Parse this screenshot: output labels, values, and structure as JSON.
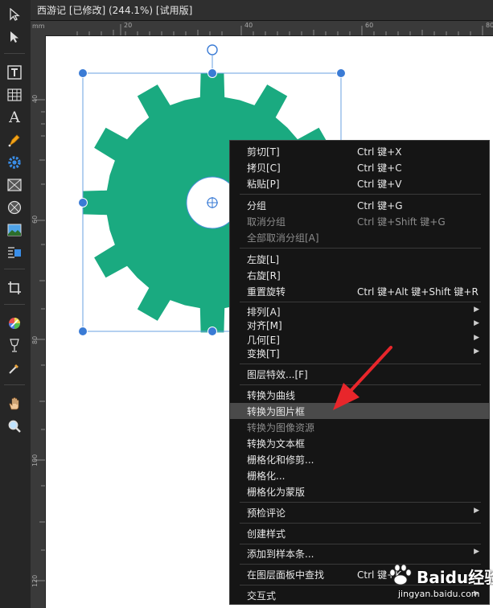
{
  "window": {
    "title": "西游记 [已修改] (244.1%) [试用版]"
  },
  "ruler": {
    "unit": "mm",
    "top_ticks": [
      "20",
      "40",
      "60",
      "80"
    ],
    "left_ticks": [
      "40",
      "60",
      "80",
      "100",
      "120"
    ]
  },
  "tools": [
    {
      "icon": "move-tool-icon"
    },
    {
      "icon": "node-tool-icon"
    },
    {
      "icon": "frame-text-tool-icon"
    },
    {
      "icon": "table-tool-icon"
    },
    {
      "icon": "artistic-text-tool-icon"
    },
    {
      "icon": "pen-tool-icon"
    },
    {
      "icon": "shape-tool-icon"
    },
    {
      "icon": "picture-frame-rectangle-icon"
    },
    {
      "icon": "picture-frame-ellipse-icon"
    },
    {
      "icon": "place-image-icon"
    },
    {
      "icon": "text-wrap-icon"
    },
    {
      "icon": "crop-tool-icon"
    },
    {
      "icon": "color-picker-icon"
    },
    {
      "icon": "transparency-tool-icon"
    },
    {
      "icon": "eyedropper-icon"
    },
    {
      "icon": "hand-tool-icon"
    },
    {
      "icon": "zoom-tool-icon"
    }
  ],
  "colors": {
    "gear": "#1aaa80",
    "selection": "#3a7bd5",
    "menu_bg": "#151515",
    "highlight": "#4a4a4a"
  },
  "context_menu": {
    "items": [
      {
        "label": "剪切[T]",
        "shortcut": "Ctrl 键+X"
      },
      {
        "label": "拷贝[C]",
        "shortcut": "Ctrl 键+C"
      },
      {
        "label": "粘贴[P]",
        "shortcut": "Ctrl 键+V"
      },
      {
        "label": "分组",
        "shortcut": "Ctrl 键+G"
      },
      {
        "label": "取消分组",
        "shortcut": "Ctrl 键+Shift 键+G",
        "disabled": true
      },
      {
        "label": "全部取消分组[A]",
        "shortcut": "",
        "disabled": true
      },
      {
        "label": "左旋[L]",
        "shortcut": ""
      },
      {
        "label": "右旋[R]",
        "shortcut": ""
      },
      {
        "label": "重置旋转",
        "shortcut": "Ctrl 键+Alt 键+Shift 键+R"
      },
      {
        "label": "排列[A]",
        "shortcut": "",
        "submenu": true
      },
      {
        "label": "对齐[M]",
        "shortcut": "",
        "submenu": true
      },
      {
        "label": "几何[E]",
        "shortcut": "",
        "submenu": true
      },
      {
        "label": "变换[T]",
        "shortcut": "",
        "submenu": true
      },
      {
        "label": "图层特效...[F]",
        "shortcut": ""
      },
      {
        "label": "转换为曲线",
        "shortcut": ""
      },
      {
        "label": "转换为图片框",
        "shortcut": "",
        "highlighted": true
      },
      {
        "label": "转换为图像资源",
        "shortcut": "",
        "disabled": true
      },
      {
        "label": "转换为文本框",
        "shortcut": ""
      },
      {
        "label": "栅格化和修剪...",
        "shortcut": ""
      },
      {
        "label": "栅格化...",
        "shortcut": ""
      },
      {
        "label": "栅格化为蒙版",
        "shortcut": ""
      },
      {
        "label": "预检评论",
        "shortcut": "",
        "submenu": true
      },
      {
        "label": "创建样式",
        "shortcut": ""
      },
      {
        "label": "添加到样本条...",
        "shortcut": "",
        "submenu": true
      },
      {
        "label": "在图层面板中查找",
        "shortcut": "Ctrl 键+K"
      },
      {
        "label": "交互式",
        "shortcut": "",
        "submenu": true
      }
    ]
  },
  "watermark": {
    "brand": "Baidu经验",
    "url": "jingyan.baidu.com"
  }
}
